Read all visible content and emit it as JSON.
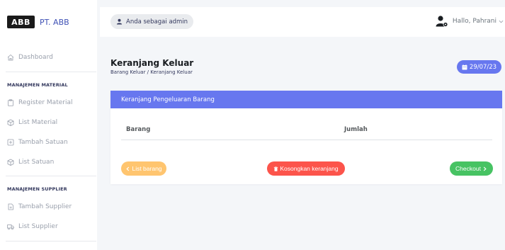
{
  "brand": {
    "logo_text": "ABB",
    "name": "PT. ABB"
  },
  "sidebar": {
    "dashboard": "Dashboard",
    "section_material": "MANAJEMEN MATERIAL",
    "register_material": "Register Material",
    "list_material": "List Material",
    "tambah_satuan": "Tambah Satuan",
    "list_satuan": "List Satuan",
    "section_supplier": "MANAJEMEN SUPPLIER",
    "tambah_supplier": "Tambah Supplier",
    "list_supplier": "List Supplier"
  },
  "topbar": {
    "role_label": "Anda sebagai admin",
    "greeting": "Hallo, Pahrani"
  },
  "page": {
    "title": "Keranjang Keluar",
    "breadcrumb": "Barang Keluar / Keranjang Keluar",
    "date": "29/07/23"
  },
  "card": {
    "header": "Keranjang Pengeluaran Barang",
    "columns": [
      "Barang",
      "Jumlah"
    ],
    "buttons": {
      "list_barang": "List barang",
      "kosongkan": "Kosongkan keranjang",
      "checkout": "Checkout"
    }
  },
  "colors": {
    "primary": "#6777ef",
    "warning": "#ffc56f",
    "danger": "#fc544b",
    "success": "#47c363"
  }
}
